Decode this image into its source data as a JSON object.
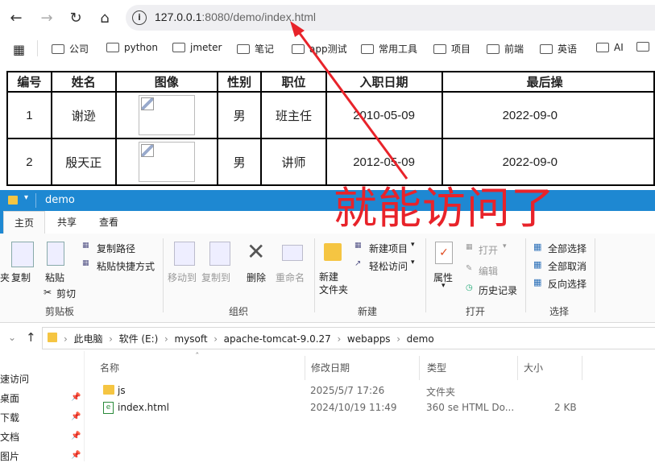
{
  "browser": {
    "url_host": "127.0.0.1",
    "url_rest": ":8080/demo/index.html",
    "bookmarks": [
      "公司",
      "python",
      "jmeter",
      "笔记",
      "app测试",
      "常用工具",
      "项目",
      "前端",
      "英语",
      "AI"
    ]
  },
  "table": {
    "headers": [
      "编号",
      "姓名",
      "图像",
      "性别",
      "职位",
      "入职日期",
      "最后操"
    ],
    "rows": [
      {
        "id": "1",
        "name": "谢逊",
        "gender": "男",
        "position": "班主任",
        "entry_date": "2010-05-09",
        "last_op": "2022-09-0"
      },
      {
        "id": "2",
        "name": "殷天正",
        "gender": "男",
        "position": "讲师",
        "entry_date": "2012-05-09",
        "last_op": "2022-09-0"
      }
    ]
  },
  "annotation": {
    "text": "就能访问了",
    "color": "#e8232a"
  },
  "explorer": {
    "title": "demo",
    "tabs": [
      "主页",
      "共享",
      "查看"
    ],
    "clipboard": {
      "copy_path": "复制路径",
      "paste_shortcut": "粘贴快捷方式",
      "copy": "复制",
      "paste": "粘贴",
      "cut": "剪切",
      "group": "剪贴板",
      "pin_left": "夹"
    },
    "organize": {
      "move_to": "移动到",
      "copy_to": "复制到",
      "delete": "删除",
      "rename": "重命名",
      "group": "组织"
    },
    "new": {
      "new_item": "新建项目",
      "easy_access": "轻松访问",
      "new_folder": "新建\n文件夹",
      "group": "新建"
    },
    "open": {
      "properties": "属性",
      "open": "打开",
      "edit": "编辑",
      "history": "历史记录",
      "group": "打开"
    },
    "select": {
      "select_all": "全部选择",
      "select_none": "全部取消",
      "invert": "反向选择",
      "group": "选择"
    },
    "path": [
      "此电脑",
      "软件 (E:)",
      "mysoft",
      "apache-tomcat-9.0.27",
      "webapps",
      "demo"
    ],
    "columns": {
      "name": "名称",
      "modified": "修改日期",
      "type": "类型",
      "size": "大小"
    },
    "files": [
      {
        "name": "js",
        "modified": "2025/5/7 17:26",
        "type": "文件夹",
        "size": ""
      },
      {
        "name": "index.html",
        "modified": "2024/10/19 11:49",
        "type": "360 se HTML Do...",
        "size": "2 KB"
      }
    ],
    "sidebar": [
      "快速访问",
      "桌面",
      "下载",
      "文档",
      "图片"
    ]
  },
  "colors": {
    "titlebar": "#1e88d2",
    "annotation": "#e8232a"
  }
}
